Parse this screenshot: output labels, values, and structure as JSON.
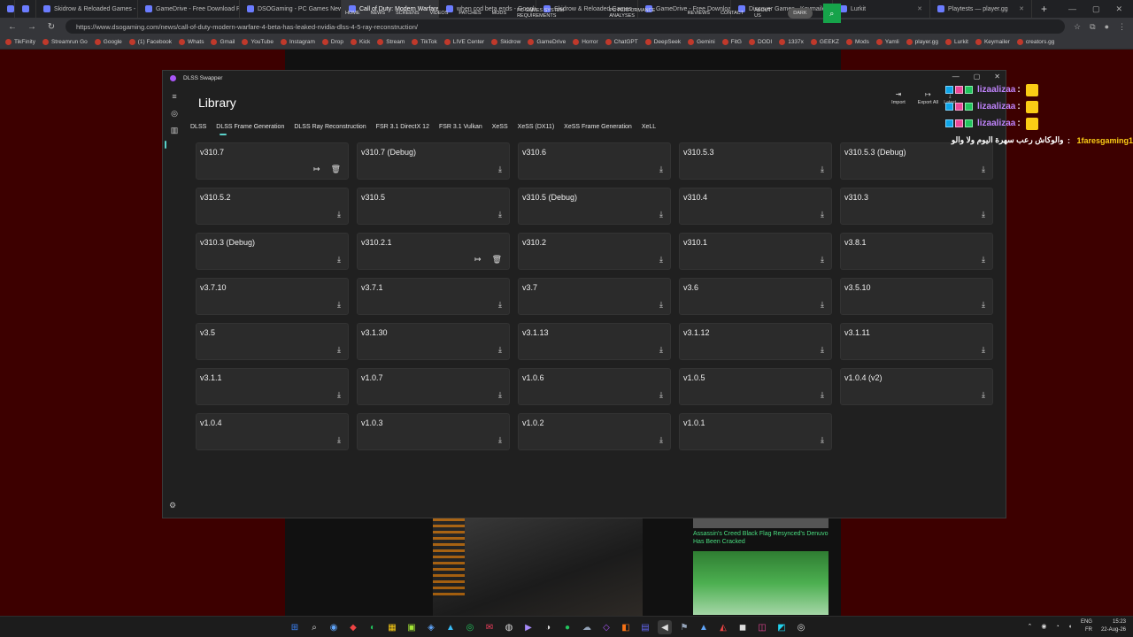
{
  "browser": {
    "tabs": [
      {
        "label": ""
      },
      {
        "label": ""
      },
      {
        "label": "Skidrow & Reloaded Games -"
      },
      {
        "label": "GameDrive - Free Download P"
      },
      {
        "label": "DSOGaming - PC Games New"
      },
      {
        "label": "Call of Duty: Modern Warfare 4"
      },
      {
        "label": "when cod beta ends - Google"
      },
      {
        "label": "Skidrow & Reloaded Games - I"
      },
      {
        "label": "GameDrive - Free Download P"
      },
      {
        "label": "Discover Games - Keymailer"
      },
      {
        "label": "Lurkit"
      },
      {
        "label": "Playtests — player.gg"
      }
    ],
    "url": "https://www.dsogaming.com/news/call-of-duty-modern-warfare-4-beta-has-leaked-nvidia-dlss-4-5-ray-reconstruction/",
    "bookmarks": [
      "TikFinity",
      "Streamrun Go",
      "Google",
      "(1) Facebook",
      "Whats",
      "Gmail",
      "YouTube",
      "Instagram",
      "Drop",
      "Kick",
      "Stream",
      "TikTok",
      "LIVE Center",
      "Skidrow",
      "GameDrive",
      "Horror",
      "ChatGPT",
      "DeepSeek",
      "Gemini",
      "FitG",
      "DODI",
      "1337x",
      "GEEKZ",
      "Mods",
      "Yamli",
      "player.gg",
      "Lurkit",
      "Keymailer",
      "creators.gg"
    ]
  },
  "site": {
    "nav": [
      "HOME",
      "NEWS",
      "SCREENS",
      "VIDEOS",
      "PATCHES",
      "MODS",
      "PC GAMES SYSTEM REQUIREMENTS",
      "PC PERFORMANCE ANALYSES",
      "REVIEWS",
      "CONTACT",
      "ABOUT US"
    ],
    "dark_label": "DARK",
    "side_caption": "Assassin's Creed Black Flag Resynced's Denuvo Has Been Cracked"
  },
  "app": {
    "window_title": "DLSS Swapper",
    "title": "Library",
    "actions": {
      "import": "Import",
      "export_all": "Export All"
    },
    "latest_label": "Latest",
    "tabs": [
      "DLSS",
      "DLSS Frame Generation",
      "DLSS Ray Reconstruction",
      "FSR 3.1 DirectX 12",
      "FSR 3.1 Vulkan",
      "XeSS",
      "XeSS (DX11)",
      "XeSS Frame Generation",
      "XeLL"
    ],
    "selected_tab": "DLSS",
    "versions": [
      {
        "label": "v310.7",
        "installed": true
      },
      {
        "label": "v310.7 (Debug)",
        "installed": false
      },
      {
        "label": "v310.6",
        "installed": false
      },
      {
        "label": "v310.5.3",
        "installed": false
      },
      {
        "label": "v310.5.3 (Debug)",
        "installed": false
      },
      {
        "label": "v310.5.2",
        "installed": false
      },
      {
        "label": "v310.5",
        "installed": false
      },
      {
        "label": "v310.5 (Debug)",
        "installed": false
      },
      {
        "label": "v310.4",
        "installed": false
      },
      {
        "label": "v310.3",
        "installed": false
      },
      {
        "label": "v310.3 (Debug)",
        "installed": false
      },
      {
        "label": "v310.2.1",
        "installed": true
      },
      {
        "label": "v310.2",
        "installed": false
      },
      {
        "label": "v310.1",
        "installed": false
      },
      {
        "label": "v3.8.1",
        "installed": false
      },
      {
        "label": "v3.7.10",
        "installed": false
      },
      {
        "label": "v3.7.1",
        "installed": false
      },
      {
        "label": "v3.7",
        "installed": false
      },
      {
        "label": "v3.6",
        "installed": false
      },
      {
        "label": "v3.5.10",
        "installed": false
      },
      {
        "label": "v3.5",
        "installed": false
      },
      {
        "label": "v3.1.30",
        "installed": false
      },
      {
        "label": "v3.1.13",
        "installed": false
      },
      {
        "label": "v3.1.12",
        "installed": false
      },
      {
        "label": "v3.1.11",
        "installed": false
      },
      {
        "label": "v3.1.1",
        "installed": false
      },
      {
        "label": "v1.0.7",
        "installed": false
      },
      {
        "label": "v1.0.6",
        "installed": false
      },
      {
        "label": "v1.0.5",
        "installed": false
      },
      {
        "label": "v1.0.4 (v2)",
        "installed": false
      },
      {
        "label": "v1.0.4",
        "installed": false
      },
      {
        "label": "v1.0.3",
        "installed": false
      },
      {
        "label": "v1.0.2",
        "installed": false
      },
      {
        "label": "v1.0.1",
        "installed": false
      }
    ],
    "accent_color": "#5ad1c9"
  },
  "chat": [
    {
      "name": "lizaalizaa",
      "sep": ":"
    },
    {
      "name": "lizaalizaa",
      "sep": ":"
    },
    {
      "name": "lizaalizaa",
      "sep": ":"
    }
  ],
  "chat_rtl": {
    "name": "1faresgaming1",
    "message": "والوكاش رعب سهرة اليوم ولا والو"
  },
  "tray": {
    "lang_top": "ENG",
    "lang_bottom": "FR",
    "time": "15:23",
    "date": "22-Aug-26"
  }
}
